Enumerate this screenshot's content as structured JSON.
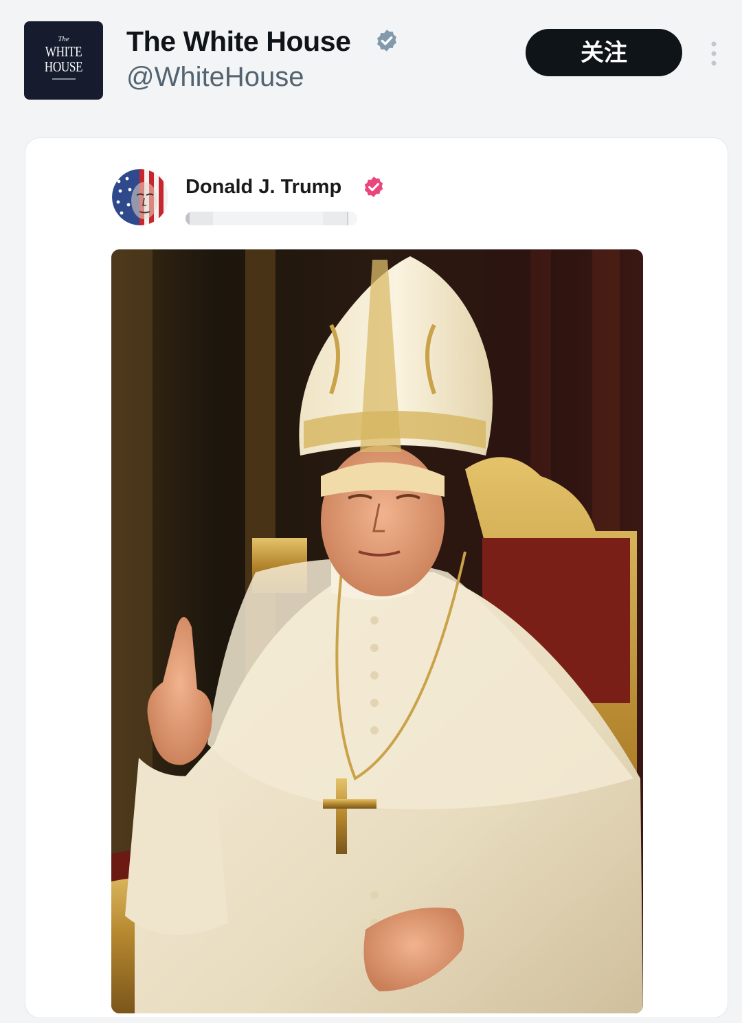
{
  "account": {
    "name": "The White House",
    "handle": "@WhiteHouse",
    "logo_text": {
      "small": "The",
      "line1": "WHITE",
      "line2": "HOUSE"
    },
    "verified_color": "#829aab"
  },
  "actions": {
    "follow_label": "关注",
    "more_icon": "more-vertical-icon"
  },
  "quoted_post": {
    "author_name": "Donald J. Trump",
    "handle_redacted": true,
    "verified_color": "#e8467c",
    "image_alt": "Donald J. Trump dressed as the Pope, seated on a gilded throne, raising one finger"
  },
  "colors": {
    "follow_bg": "#0f1419",
    "name_text": "#0f1419",
    "handle_text": "#536471",
    "page_bg": "#f3f4f6"
  }
}
